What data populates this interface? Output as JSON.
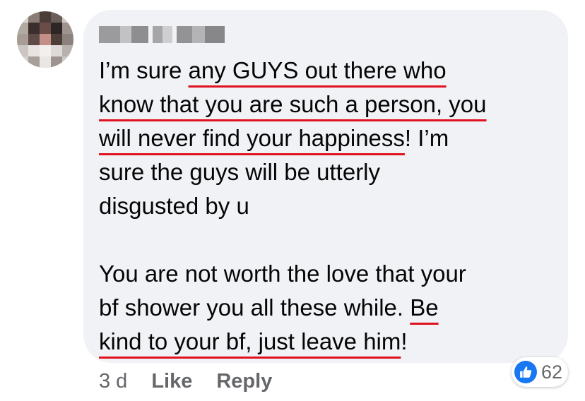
{
  "comment": {
    "author_name": "",
    "lines": [
      [
        {
          "t": "I’m sure "
        },
        {
          "t": "any GUYS out there who",
          "u": true
        }
      ],
      [
        {
          "t": "know that you are such a person, you",
          "u": true
        }
      ],
      [
        {
          "t": "will never find your happiness",
          "u": true
        },
        {
          "t": "! I’m"
        }
      ],
      [
        {
          "t": "sure the guys will be utterly"
        }
      ],
      [
        {
          "t": "disgusted by u"
        }
      ],
      [],
      [
        {
          "t": "You are not worth the love that your"
        }
      ],
      [
        {
          "t": "bf shower you all these while. "
        },
        {
          "t": "Be",
          "u": true
        }
      ],
      [
        {
          "t": "kind to your bf, just leave him",
          "u": true
        },
        {
          "t": "!"
        }
      ]
    ]
  },
  "actions": {
    "timestamp": "3 d",
    "like_label": "Like",
    "reply_label": "Reply"
  },
  "reactions": {
    "icon": "thumbs-up-icon",
    "count": "62",
    "color": "#1877f2"
  },
  "colors": {
    "bubble_bg": "#f0f2f5",
    "text": "#050505",
    "meta_text": "#65676b",
    "underline": "#e0121f"
  }
}
